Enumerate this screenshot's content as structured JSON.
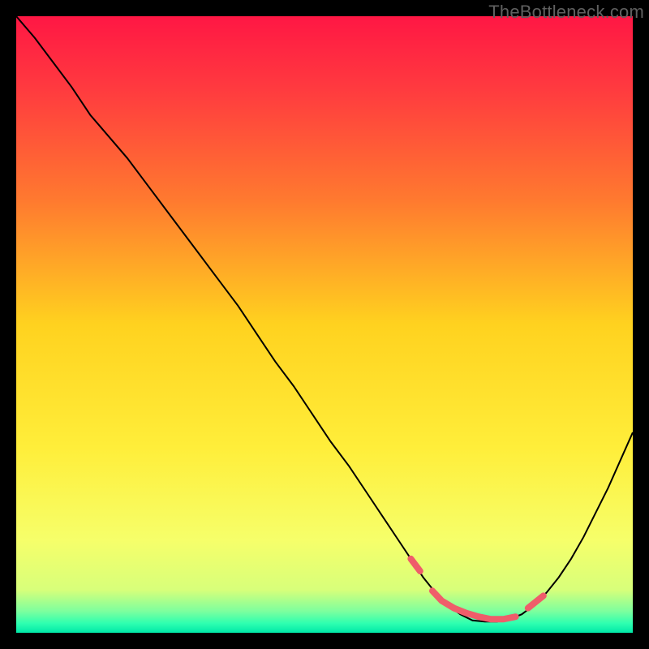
{
  "watermark": "TheBottleneck.com",
  "chart_data": {
    "type": "line",
    "title": "",
    "xlabel": "",
    "ylabel": "",
    "xlim": [
      0,
      100
    ],
    "ylim": [
      0,
      100
    ],
    "gradient_stops": [
      {
        "offset": 0.0,
        "color": "#ff1744"
      },
      {
        "offset": 0.12,
        "color": "#ff3b3f"
      },
      {
        "offset": 0.3,
        "color": "#ff7a2f"
      },
      {
        "offset": 0.5,
        "color": "#ffd21f"
      },
      {
        "offset": 0.7,
        "color": "#ffee3a"
      },
      {
        "offset": 0.85,
        "color": "#f6ff6a"
      },
      {
        "offset": 0.93,
        "color": "#d8ff7a"
      },
      {
        "offset": 0.965,
        "color": "#7dff9e"
      },
      {
        "offset": 0.985,
        "color": "#2dffb0"
      },
      {
        "offset": 1.0,
        "color": "#00e8a8"
      }
    ],
    "series": [
      {
        "name": "bottleneck-curve",
        "color": "#000000",
        "width": 2,
        "x": [
          0.0,
          3.0,
          6.0,
          9.0,
          12.0,
          15.0,
          18.0,
          21.0,
          24.0,
          27.0,
          30.0,
          33.0,
          36.0,
          39.0,
          42.0,
          45.0,
          48.0,
          51.0,
          54.0,
          57.0,
          60.0,
          62.0,
          64.0,
          66.0,
          68.0,
          70.0,
          72.0,
          74.0,
          76.0,
          78.0,
          80.0,
          82.0,
          84.0,
          86.0,
          88.0,
          90.0,
          92.0,
          94.0,
          96.0,
          98.0,
          100.0
        ],
        "y": [
          100.0,
          96.5,
          92.5,
          88.5,
          84.0,
          80.5,
          77.0,
          73.0,
          69.0,
          65.0,
          61.0,
          57.0,
          53.0,
          48.5,
          44.0,
          40.0,
          35.5,
          31.0,
          27.0,
          22.5,
          18.0,
          15.0,
          12.0,
          9.0,
          6.5,
          4.5,
          3.0,
          2.0,
          1.8,
          1.8,
          2.2,
          3.0,
          4.5,
          6.5,
          9.0,
          12.0,
          15.5,
          19.5,
          23.5,
          28.0,
          32.5
        ]
      }
    ],
    "highlight_segment": {
      "name": "sweet-spot",
      "color": "#ef5d6a",
      "width": 8,
      "segments": [
        {
          "x": [
            64.0,
            65.5
          ],
          "y": [
            12.0,
            10.0
          ]
        },
        {
          "x": [
            67.5,
            69.0,
            71.0,
            73.0,
            75.0,
            77.0,
            79.0,
            81.0
          ],
          "y": [
            6.8,
            5.2,
            4.0,
            3.2,
            2.6,
            2.2,
            2.2,
            2.6
          ]
        },
        {
          "x": [
            83.0,
            85.5
          ],
          "y": [
            4.0,
            6.0
          ]
        }
      ]
    }
  }
}
